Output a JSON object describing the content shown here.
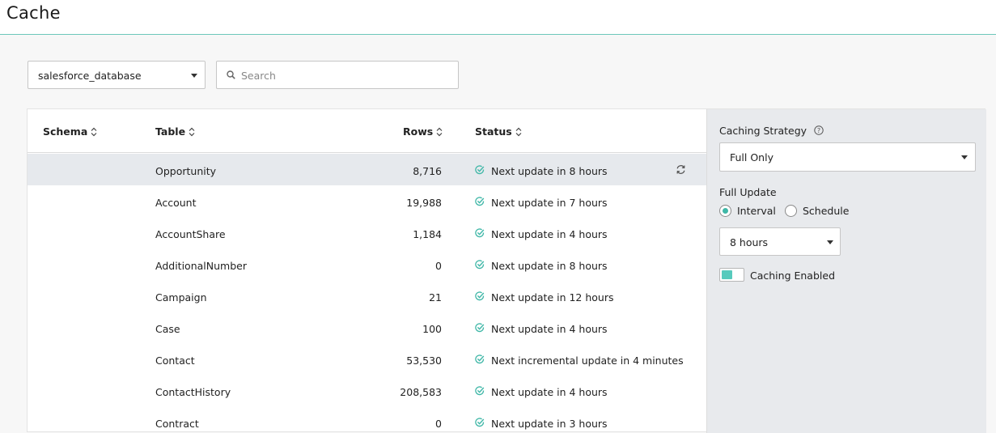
{
  "page": {
    "title": "Cache"
  },
  "toolbar": {
    "database_selected": "salesforce_database",
    "search_placeholder": "Search",
    "search_value": ""
  },
  "table": {
    "headers": {
      "schema": "Schema",
      "table": "Table",
      "rows": "Rows",
      "status": "Status"
    },
    "rows": [
      {
        "schema": "",
        "table": "Opportunity",
        "rows": "8,716",
        "status": "Next update in 8 hours",
        "selected": true
      },
      {
        "schema": "",
        "table": "Account",
        "rows": "19,988",
        "status": "Next update in 7 hours"
      },
      {
        "schema": "",
        "table": "AccountShare",
        "rows": "1,184",
        "status": "Next update in 4 hours"
      },
      {
        "schema": "",
        "table": "AdditionalNumber",
        "rows": "0",
        "status": "Next update in 8 hours"
      },
      {
        "schema": "",
        "table": "Campaign",
        "rows": "21",
        "status": "Next update in 12 hours"
      },
      {
        "schema": "",
        "table": "Case",
        "rows": "100",
        "status": "Next update in 4 hours"
      },
      {
        "schema": "",
        "table": "Contact",
        "rows": "53,530",
        "status": "Next incremental update in 4 minutes"
      },
      {
        "schema": "",
        "table": "ContactHistory",
        "rows": "208,583",
        "status": "Next update in 4 hours"
      },
      {
        "schema": "",
        "table": "Contract",
        "rows": "0",
        "status": "Next update in 3 hours"
      }
    ]
  },
  "settings": {
    "strategy_label": "Caching Strategy",
    "strategy_value": "Full Only",
    "full_update_label": "Full Update",
    "radio_interval": "Interval",
    "radio_schedule": "Schedule",
    "interval_value": "8 hours",
    "caching_enabled_label": "Caching Enabled"
  },
  "colors": {
    "accent": "#3fb7a7",
    "selected_row": "#e6e9ed",
    "side_panel": "#e8eaed"
  }
}
